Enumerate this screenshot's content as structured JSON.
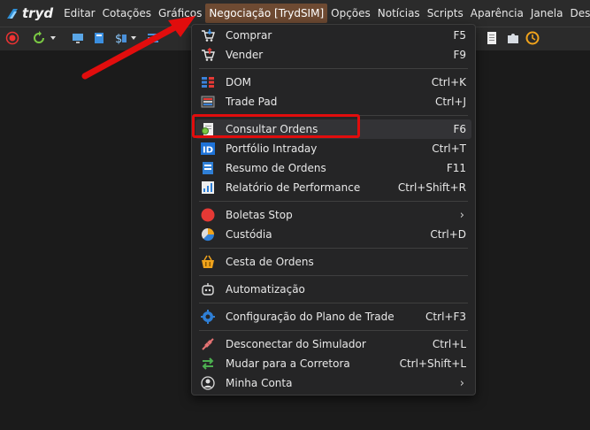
{
  "app": {
    "logo_text": "tryd"
  },
  "menubar": [
    {
      "label": "Editar"
    },
    {
      "label": "Cotações"
    },
    {
      "label": "Gráficos"
    },
    {
      "label": "Negociação [TrydSIM]",
      "active": true
    },
    {
      "label": "Opções"
    },
    {
      "label": "Notícias"
    },
    {
      "label": "Scripts"
    },
    {
      "label": "Aparência"
    },
    {
      "label": "Janela"
    },
    {
      "label": "Desktops"
    }
  ],
  "menu": {
    "items": [
      {
        "label": "Comprar",
        "shortcut": "F5",
        "icon": "buy-cart-icon"
      },
      {
        "label": "Vender",
        "shortcut": "F9",
        "icon": "sell-cart-icon"
      },
      {
        "label": "DOM",
        "shortcut": "Ctrl+K",
        "icon": "dom-grid-icon"
      },
      {
        "label": "Trade Pad",
        "shortcut": "Ctrl+J",
        "icon": "trade-pad-icon"
      },
      {
        "label": "Consultar Ordens",
        "shortcut": "F6",
        "icon": "search-orders-icon",
        "highlighted": true
      },
      {
        "label": "Portfólio Intraday",
        "shortcut": "Ctrl+T",
        "icon": "id-icon"
      },
      {
        "label": "Resumo de Ordens",
        "shortcut": "F11",
        "icon": "orders-summary-icon"
      },
      {
        "label": "Relatório de Performance",
        "shortcut": "Ctrl+Shift+R",
        "icon": "performance-report-icon"
      },
      {
        "label": "Boletas Stop",
        "shortcut": "",
        "icon": "stop-circle-icon",
        "submenu": true
      },
      {
        "label": "Custódia",
        "shortcut": "Ctrl+D",
        "icon": "custody-pie-icon"
      },
      {
        "label": "Cesta de Ordens",
        "shortcut": "",
        "icon": "basket-icon"
      },
      {
        "label": "Automatização",
        "shortcut": "",
        "icon": "robot-icon"
      },
      {
        "label": "Configuração do Plano de Trade",
        "shortcut": "Ctrl+F3",
        "icon": "plan-settings-icon"
      },
      {
        "label": "Desconectar do Simulador",
        "shortcut": "Ctrl+L",
        "icon": "disconnect-icon"
      },
      {
        "label": "Mudar para a Corretora",
        "shortcut": "Ctrl+Shift+L",
        "icon": "switch-arrows-icon"
      },
      {
        "label": "Minha Conta",
        "shortcut": "",
        "icon": "user-account-icon",
        "submenu": true
      }
    ]
  },
  "colors": {
    "menubar_bg": "#2b2b2b",
    "active_menu_bg": "#6e4a32",
    "dropdown_bg": "#252526",
    "annotation_red": "#e10d0d"
  }
}
